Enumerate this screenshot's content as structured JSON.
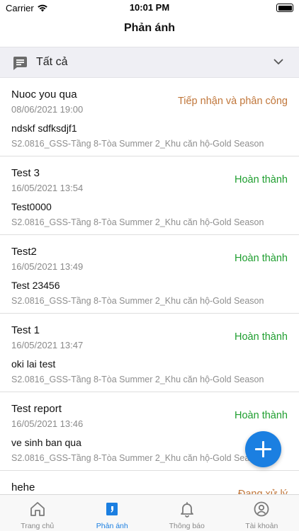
{
  "status_bar": {
    "carrier": "Carrier",
    "time": "10:01 PM"
  },
  "header": {
    "title": "Phản ánh"
  },
  "filter": {
    "label": "Tất cả"
  },
  "items": [
    {
      "title": "Nuoc you qua",
      "date": "08/06/2021 19:00",
      "status": "Tiếp nhận và phân công",
      "status_color": "#c0763a",
      "content": "ndskf sdfksdjf1",
      "location": "S2.0816_GSS-Tầng 8-Tòa Summer 2_Khu căn hộ-Gold Season"
    },
    {
      "title": "Test 3",
      "date": "16/05/2021 13:54",
      "status": "Hoàn thành",
      "status_color": "#1e9e2f",
      "content": "Test0000",
      "location": "S2.0816_GSS-Tầng 8-Tòa Summer 2_Khu căn hộ-Gold Season"
    },
    {
      "title": "Test2",
      "date": "16/05/2021 13:49",
      "status": "Hoàn thành",
      "status_color": "#1e9e2f",
      "content": "Test 23456",
      "location": "S2.0816_GSS-Tầng 8-Tòa Summer 2_Khu căn hộ-Gold Season"
    },
    {
      "title": "Test 1",
      "date": "16/05/2021 13:47",
      "status": "Hoàn thành",
      "status_color": "#1e9e2f",
      "content": "oki lai test",
      "location": "S2.0816_GSS-Tầng 8-Tòa Summer 2_Khu căn hộ-Gold Season"
    },
    {
      "title": "Test report",
      "date": "16/05/2021 13:46",
      "status": "Hoàn thành",
      "status_color": "#1e9e2f",
      "content": "ve sinh ban qua",
      "location": "S2.0816_GSS-Tầng 8-Tòa Summer 2_Khu căn hộ-Gold Season"
    },
    {
      "title": "hehe",
      "date": "",
      "status": "Đang xử lý",
      "status_color": "#c0763a",
      "content": "",
      "location": ""
    }
  ],
  "fab": {
    "icon": "plus-icon",
    "color": "#1b7fe1"
  },
  "tabbar": {
    "active_color": "#1b7fe1",
    "tabs": [
      {
        "label": "Trang chủ",
        "icon": "home-icon"
      },
      {
        "label": "Phản ánh",
        "icon": "feedback-icon"
      },
      {
        "label": "Thông báo",
        "icon": "bell-icon"
      },
      {
        "label": "Tài khoản",
        "icon": "account-icon"
      }
    ]
  }
}
